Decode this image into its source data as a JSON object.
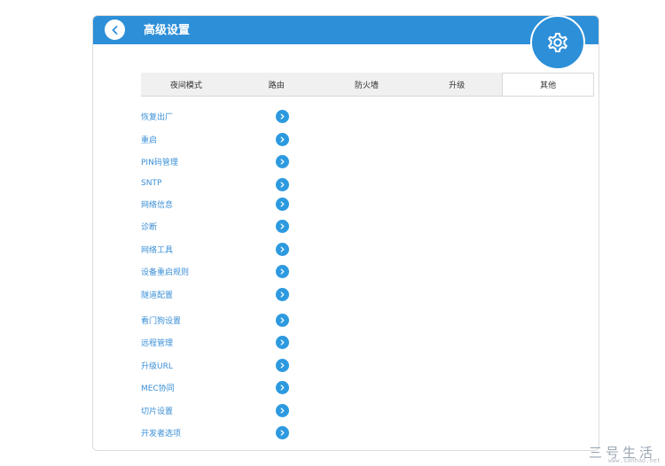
{
  "header": {
    "title": "高级设置"
  },
  "tabs": [
    {
      "label": "夜间模式",
      "active": false
    },
    {
      "label": "路由",
      "active": false
    },
    {
      "label": "防火墙",
      "active": false
    },
    {
      "label": "升级",
      "active": false
    },
    {
      "label": "其他",
      "active": true
    }
  ],
  "menu": [
    {
      "label": "恢复出厂"
    },
    {
      "label": "重启"
    },
    {
      "label": "PIN码管理"
    },
    {
      "label": "SNTP"
    },
    {
      "label": "网络信息"
    },
    {
      "label": "诊断"
    },
    {
      "label": "网络工具"
    },
    {
      "label": "设备重启规则"
    },
    {
      "label": "隧道配置"
    },
    {
      "label": "看门狗设置"
    },
    {
      "label": "远程管理"
    },
    {
      "label": "升级URL"
    },
    {
      "label": "MEC协同"
    },
    {
      "label": "切片设置"
    },
    {
      "label": "开发者选项"
    }
  ],
  "watermark": {
    "main": "三号生活",
    "sub": "www.sanhao.net"
  },
  "colors": {
    "header": "#2d8fd8",
    "link": "#3a8fd6",
    "arrow": "#2d9ae0",
    "tab_bg": "#f0f0f0"
  },
  "icons": {
    "back": "chevron-left-icon",
    "settings": "gear-icon",
    "item_arrow": "chevron-right-icon"
  }
}
